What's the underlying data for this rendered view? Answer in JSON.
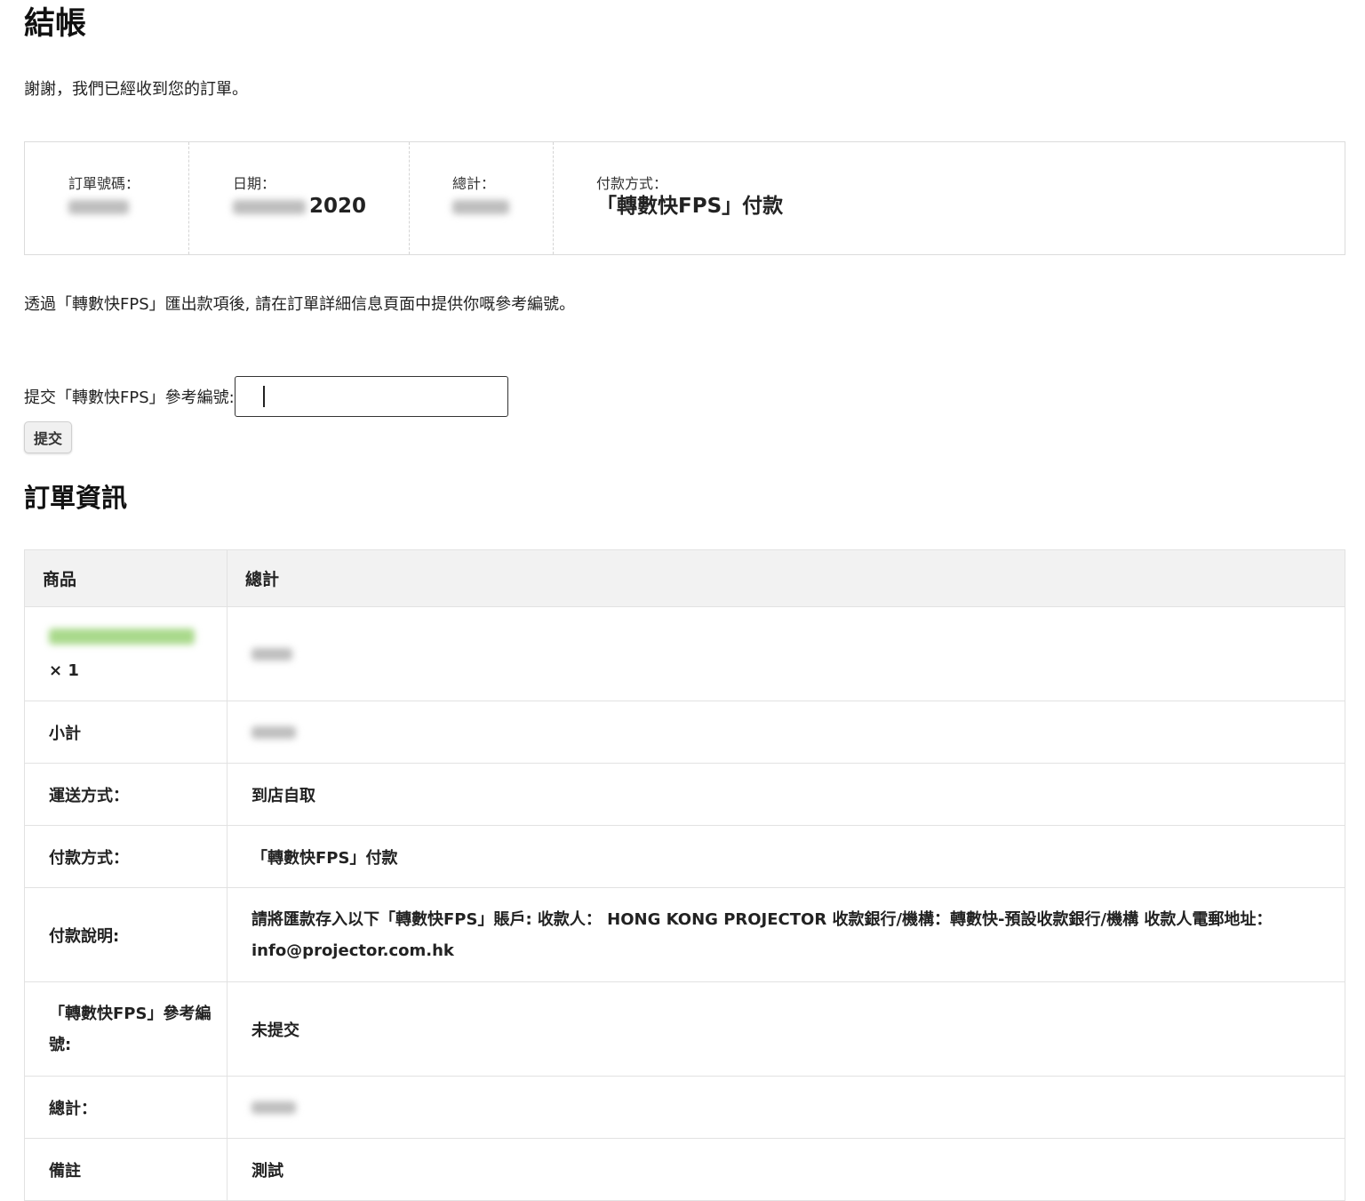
{
  "page": {
    "title": "結帳",
    "thanks_message": "謝謝，我們已經收到您的訂單。"
  },
  "overview": {
    "order_number_label": "訂單號碼：",
    "date_label": "日期：",
    "date_year": "2020",
    "total_label": "總計：",
    "payment_method_label": "付款方式：",
    "payment_method_value": "「轉數快FPS」付款"
  },
  "fps_instructions": "透過「轉數快FPS」匯出款項後, 請在訂單詳細信息頁面中提供你嘅參考編號。",
  "reference_form": {
    "label": "提交「轉數快FPS」參考編號:",
    "input_value": "",
    "submit_label": "提交"
  },
  "order_details": {
    "title": "訂單資訊",
    "columns": [
      "商品",
      "總計"
    ],
    "item_quantity": "× 1",
    "rows": [
      {
        "label": "小計"
      },
      {
        "label": "運送方式：",
        "value": "到店自取"
      },
      {
        "label": "付款方式：",
        "value": "「轉數快FPS」付款"
      },
      {
        "label": "付款說明:",
        "value": "請將匯款存入以下「轉數快FPS」賬戶: 收款人： HONG KONG PROJECTOR 收款銀行/機構：轉數快-預設收款銀行/機構 收款人電郵地址：info@projector.com.hk"
      },
      {
        "label": "「轉數快FPS」參考編號:",
        "value": "未提交"
      },
      {
        "label": "總計："
      },
      {
        "label": "備註",
        "value": "測試"
      }
    ]
  },
  "colors": {
    "border": "#dcdcdc",
    "table_header_bg": "#f2f2f2",
    "product_link": "#a9d98b"
  }
}
